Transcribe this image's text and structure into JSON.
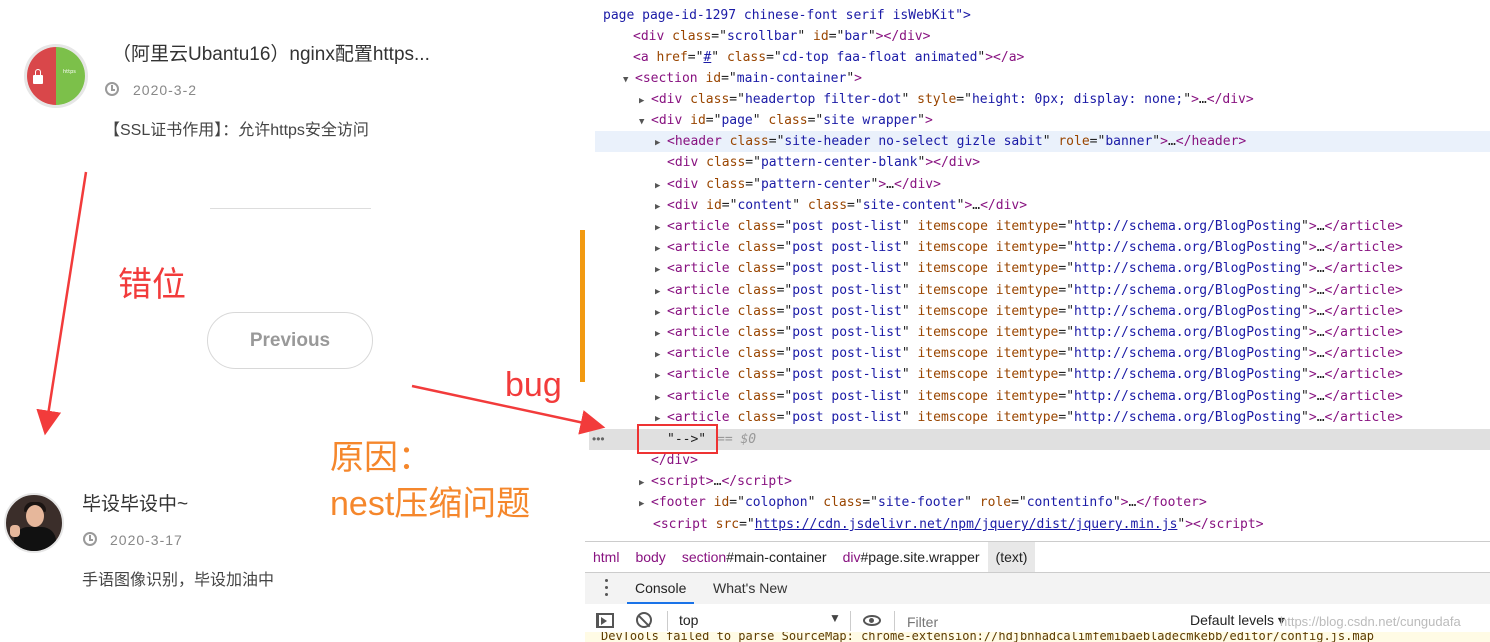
{
  "blog": {
    "post1": {
      "title": "（阿里云Ubantu16）nginx配置https...",
      "date": "2020-3-2",
      "excerpt": "【SSL证书作用】：允许https安全访问",
      "avatar_tag": "https"
    },
    "previous_label": "Previous",
    "post2": {
      "title": "毕设毕设中~",
      "date": "2020-3-17",
      "excerpt": "手语图像识别，毕设加油中"
    }
  },
  "annotations": {
    "misplaced": "错位",
    "bug": "bug",
    "cause_line1": "原因：",
    "cause_line2": "nest压缩问题",
    "colors": {
      "red": "#f23b3b",
      "orange": "#f5872c"
    }
  },
  "devtools": {
    "elements": {
      "line0": {
        "t1": "page page-id-1297 chinese-font serif isWebKit\">"
      },
      "scrollbar": {
        "tag": "div",
        "a1": "class",
        "v1": "scrollbar",
        "a2": "id",
        "v2": "bar"
      },
      "cdtop": {
        "tag": "a",
        "a1": "href",
        "v1": "#",
        "a2": "class",
        "v2": "cd-top faa-float animated"
      },
      "main": {
        "tag": "section",
        "a1": "id",
        "v1": "main-container"
      },
      "headertop": {
        "tag": "div",
        "a1": "class",
        "v1": "headertop filter-dot",
        "a2": "style",
        "v2": "height: 0px; display: none;"
      },
      "page": {
        "tag": "div",
        "a1": "id",
        "v1": "page",
        "a2": "class",
        "v2": "site wrapper"
      },
      "header": {
        "tag": "header",
        "a1": "class",
        "v1": "site-header no-select gizle sabit",
        "a2": "role",
        "v2": "banner"
      },
      "blank": {
        "tag": "div",
        "a1": "class",
        "v1": "pattern-center-blank"
      },
      "pattern": {
        "tag": "div",
        "a1": "class",
        "v1": "pattern-center"
      },
      "content": {
        "tag": "div",
        "a1": "id",
        "v1": "content",
        "a2": "class",
        "v2": "site-content"
      },
      "article": {
        "tag": "article",
        "a1": "class",
        "v1": "post post-list",
        "a2": "itemscope",
        "a3": "itemtype",
        "v3": "http://schema.org/BlogPosting"
      },
      "textnode": {
        "text": "\"-->\"",
        "eq": "== $0"
      },
      "close_div": "</div>",
      "script1": {
        "tag": "script"
      },
      "footer": {
        "tag": "footer",
        "a1": "id",
        "v1": "colophon",
        "a2": "class",
        "v2": "site-footer",
        "a3": "role",
        "v3": "contentinfo"
      },
      "script2": {
        "tag": "script",
        "a1": "src",
        "v1": "https://cdn.jsdelivr.net/npm/jquery/dist/jquery.min.js"
      }
    },
    "breadcrumb": {
      "c1": "html",
      "c2": "body",
      "c3_tag": "section",
      "c3_id": "#main-container",
      "c4_tag": "div",
      "c4_cls": "#page.site.wrapper",
      "c5": "(text)"
    },
    "tabs": {
      "console": "Console",
      "whats_new": "What's New"
    },
    "toolbar": {
      "context": "top",
      "filter_placeholder": "Filter",
      "levels": "Default levels ▾",
      "watermark": "https://blog.csdn.net/cungudafa"
    },
    "warning": "DevTools failed to parse SourceMap: chrome-extension://hdjbnhadcalimfemibaebladecmkebb/editor/config.js.map"
  }
}
